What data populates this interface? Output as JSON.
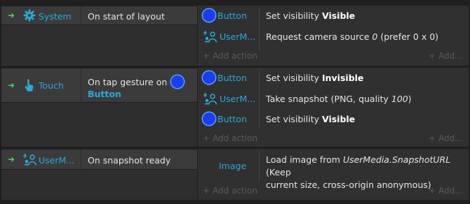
{
  "events": [
    {
      "condition": {
        "object": "System",
        "icon": "gear-icon",
        "text": "On start of layout"
      },
      "actions": [
        {
          "object": "Button",
          "icon": "button-circle-icon",
          "text_plain": "Set visibility ",
          "text_bold": "Visible"
        },
        {
          "object": "UserM...",
          "icon": "usermedia-icon",
          "text_plain": "Request camera source ",
          "text_italic": "0",
          "text_tail": " (prefer 0 x 0)"
        }
      ]
    },
    {
      "condition": {
        "object": "Touch",
        "icon": "touch-icon",
        "text": "On tap gesture on",
        "text_object": "Button"
      },
      "actions": [
        {
          "object": "Button",
          "icon": "button-circle-icon",
          "text_plain": "Set visibility ",
          "text_bold": "Invisible"
        },
        {
          "object": "UserM...",
          "icon": "usermedia-icon",
          "text_plain": "Take snapshot (PNG, quality ",
          "text_italic": "100",
          "text_tail": ")"
        },
        {
          "object": "Button",
          "icon": "button-circle-icon",
          "text_plain": "Set visibility ",
          "text_bold": "Visible"
        }
      ]
    },
    {
      "condition": {
        "object": "UserM...",
        "icon": "usermedia-icon",
        "text": "On snapshot ready"
      },
      "actions": [
        {
          "object": "Image",
          "text_plain": "Load image from ",
          "text_italic": "UserMedia.SnapshotURL",
          "text_tail": " (Keep",
          "text_line2": "current size, cross-origin anonymous)"
        }
      ]
    }
  ],
  "add_action_label": "Add action",
  "add_more_label": "Add...",
  "plus": "+",
  "arrow": "➜",
  "colors": {
    "object_name": "#2aa9d8",
    "arrow": "#46d66a",
    "button_fill": "#1c3cf0"
  }
}
